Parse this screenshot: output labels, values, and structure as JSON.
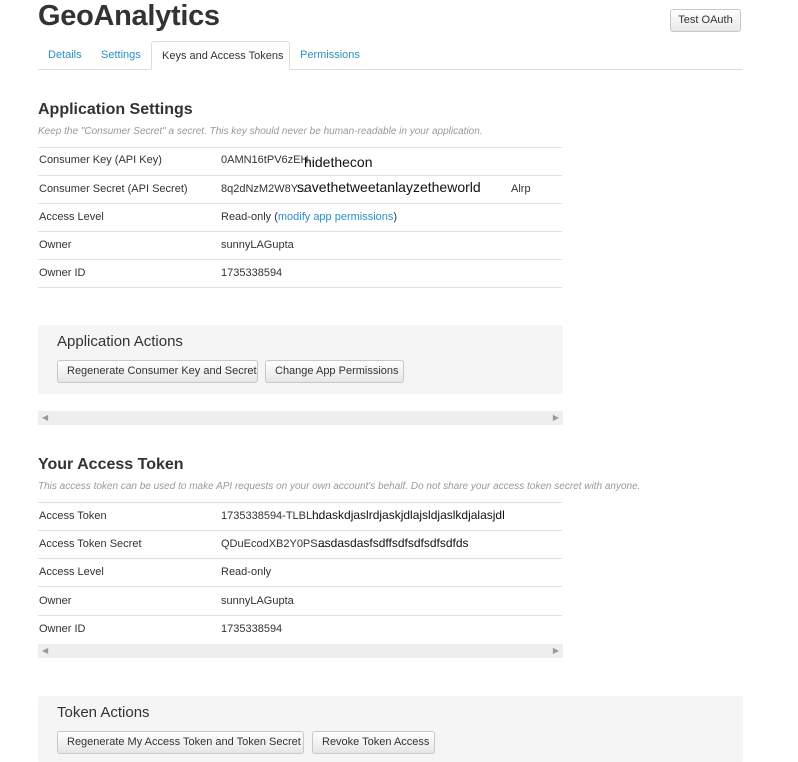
{
  "app": {
    "title": "GeoAnalytics",
    "test_oauth_label": "Test OAuth"
  },
  "tabs": [
    {
      "label": "Details"
    },
    {
      "label": "Settings"
    },
    {
      "label": "Keys and Access Tokens"
    },
    {
      "label": "Permissions"
    }
  ],
  "app_settings": {
    "heading": "Application Settings",
    "description": "Keep the \"Consumer Secret\" a secret. This key should never be human-readable in your application.",
    "rows": [
      {
        "label": "Consumer Key (API Key)",
        "value": "0AMN16tPV6zEH...",
        "overlay": "hidethecon"
      },
      {
        "label": "Consumer Secret (API Secret)",
        "value": "8q2dNzM2W8Y...",
        "suffix": "Alrp",
        "overlay": "savethetweetanlayzetheworld"
      },
      {
        "label": "Access Level",
        "value_prefix": "Read-only (",
        "link": "modify app permissions",
        "value_suffix": ")"
      },
      {
        "label": "Owner",
        "value": "sunnyLAGupta"
      },
      {
        "label": "Owner ID",
        "value": "1735338594"
      }
    ]
  },
  "app_actions": {
    "heading": "Application Actions",
    "regen_label": "Regenerate Consumer Key and Secret",
    "change_perm_label": "Change App Permissions"
  },
  "access_token": {
    "heading": "Your Access Token",
    "description": "This access token can be used to make API requests on your own account's behalf. Do not share your access token secret with anyone.",
    "rows": [
      {
        "label": "Access Token",
        "value": "1735338594-TLBL...",
        "overlay": "hdaskdjaslrdjaskjdlajsldjaslkdjalasjdl"
      },
      {
        "label": "Access Token Secret",
        "value": "QDuEcodXB2Y0PS...",
        "overlay": "asdasdasfsdffsdfsdfsdfsdfds"
      },
      {
        "label": "Access Level",
        "value": "Read-only"
      },
      {
        "label": "Owner",
        "value": "sunnyLAGupta"
      },
      {
        "label": "Owner ID",
        "value": "1735338594"
      }
    ]
  },
  "token_actions": {
    "heading": "Token Actions",
    "regen_label": "Regenerate My Access Token and Token Secret",
    "revoke_label": "Revoke Token Access"
  },
  "icons": {
    "scroll_left": "triangle-left-icon",
    "scroll_right": "triangle-right-icon"
  }
}
